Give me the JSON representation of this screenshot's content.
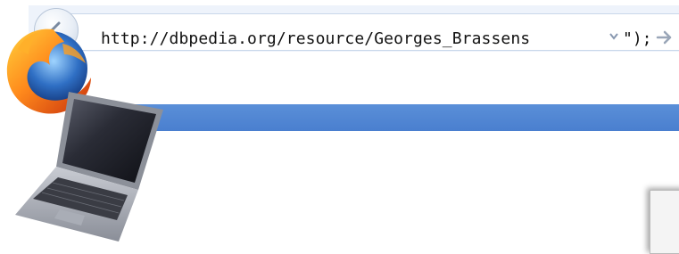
{
  "address_bar": {
    "url": "http://dbpedia.org/resource/Georges_Brassens",
    "suffix": "\");"
  },
  "icons": {
    "back": "back-arrow-icon",
    "forward": "forward-arrow-icon",
    "dropdown": "dropdown-arrow-icon",
    "browser_logo": "firefox-logo-icon",
    "computer": "laptop-icon"
  },
  "colors": {
    "band": "#4f86d4",
    "urlbar_bg": "#eef3fb"
  }
}
